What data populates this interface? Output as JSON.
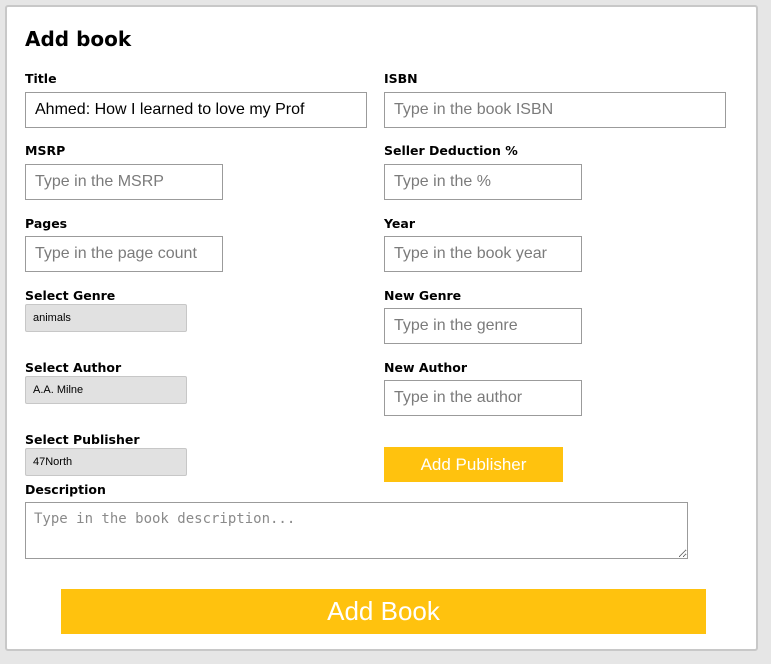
{
  "form": {
    "heading": "Add book",
    "title": {
      "label": "Title",
      "value": "Ahmed: How I learned to love my Prof"
    },
    "isbn": {
      "label": "ISBN",
      "placeholder": "Type in the book ISBN"
    },
    "msrp": {
      "label": "MSRP",
      "placeholder": "Type in the MSRP"
    },
    "seller_deduction": {
      "label": "Seller Deduction %",
      "placeholder": "Type in the %"
    },
    "pages": {
      "label": "Pages",
      "placeholder": "Type in the page count"
    },
    "year": {
      "label": "Year",
      "placeholder": "Type in the book year"
    },
    "select_genre": {
      "label": "Select Genre",
      "selected": "animals"
    },
    "new_genre": {
      "label": "New Genre",
      "placeholder": "Type in the genre"
    },
    "select_author": {
      "label": "Select Author",
      "selected": "A.A. Milne"
    },
    "new_author": {
      "label": "New Author",
      "placeholder": "Type in the author"
    },
    "select_publisher": {
      "label": "Select Publisher",
      "selected": "47North"
    },
    "add_publisher_label": "Add Publisher",
    "description": {
      "label": "Description",
      "placeholder": "Type in the book description..."
    },
    "add_book_label": "Add Book"
  },
  "colors": {
    "accent": "#ffc20e",
    "select_bg": "#e1e1e1",
    "border": "#9b9b9b"
  }
}
